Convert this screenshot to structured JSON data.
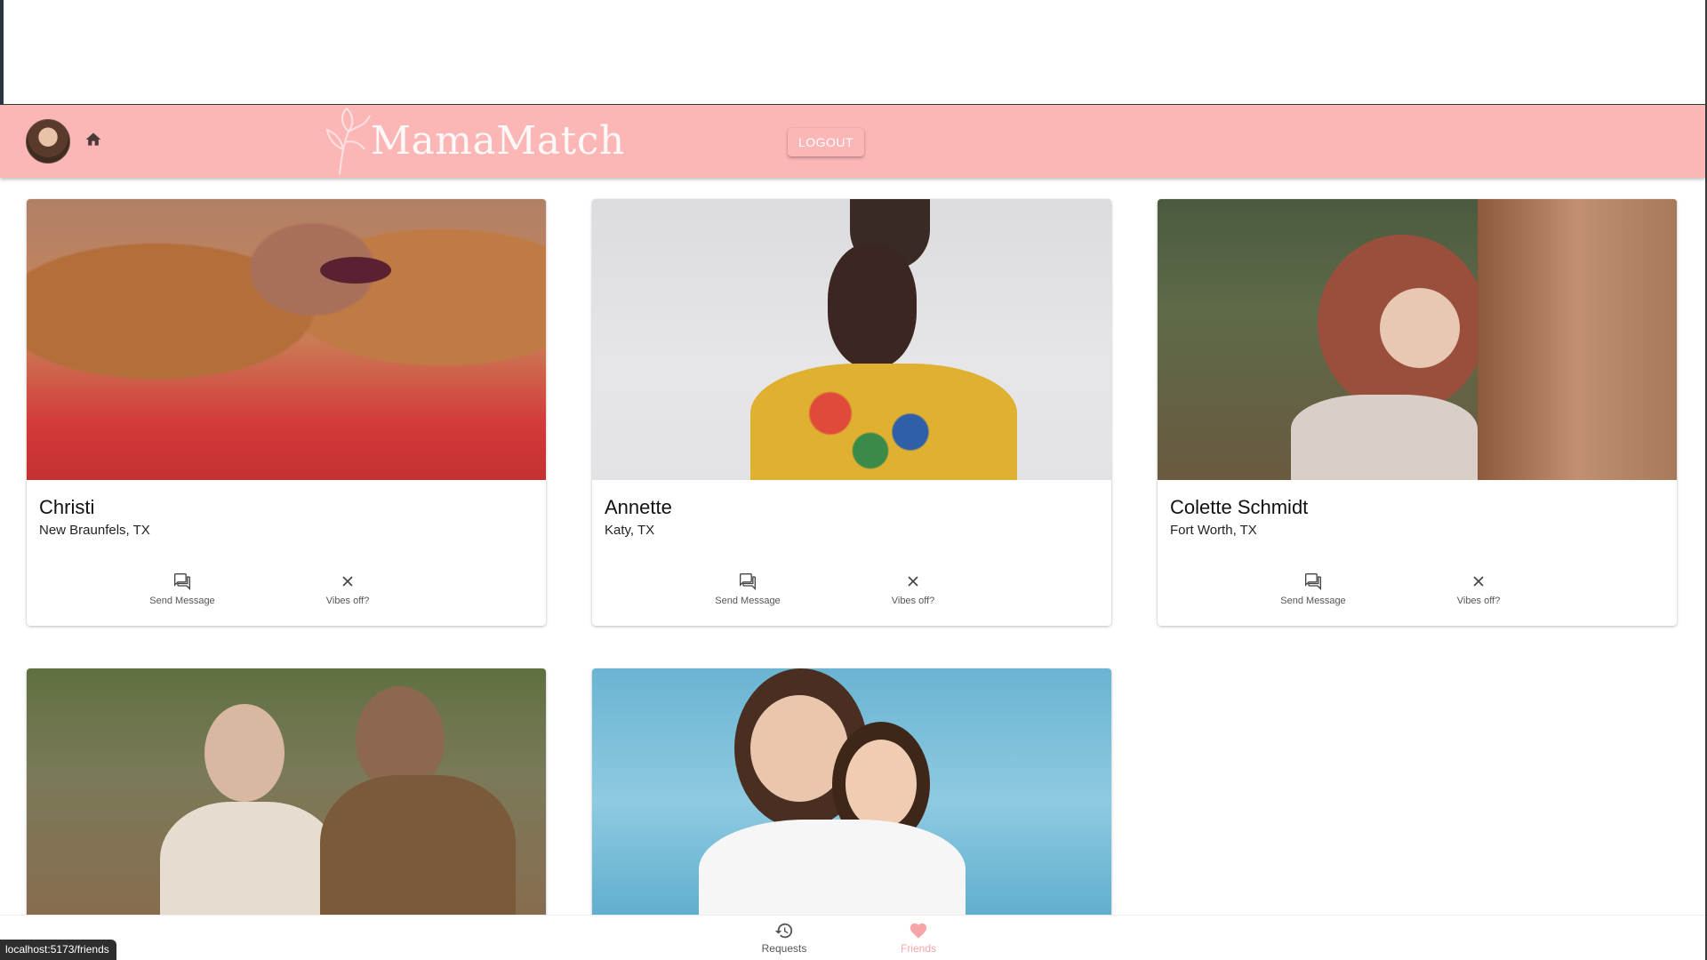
{
  "brand": {
    "name": "MamaMatch",
    "color": "#fbb6b5"
  },
  "header": {
    "logout_label": "LOGOUT"
  },
  "friends": [
    {
      "name": "Christi",
      "location": "New Braunfels, TX",
      "send_label": "Send Message",
      "vibes_label": "Vibes off?"
    },
    {
      "name": "Annette",
      "location": "Katy, TX",
      "send_label": "Send Message",
      "vibes_label": "Vibes off?"
    },
    {
      "name": "Colette Schmidt",
      "location": "Fort Worth, TX",
      "send_label": "Send Message",
      "vibes_label": "Vibes off?"
    },
    {
      "name": "",
      "location": ""
    },
    {
      "name": "",
      "location": ""
    }
  ],
  "bottom_nav": {
    "requests_label": "Requests",
    "friends_label": "Friends",
    "active": "Friends",
    "active_color": "#f6a6a6"
  },
  "status_bar": {
    "url": "localhost:5173/friends"
  },
  "icons": [
    "home-icon",
    "chat-icon",
    "close-icon",
    "history-icon",
    "heart-icon"
  ]
}
